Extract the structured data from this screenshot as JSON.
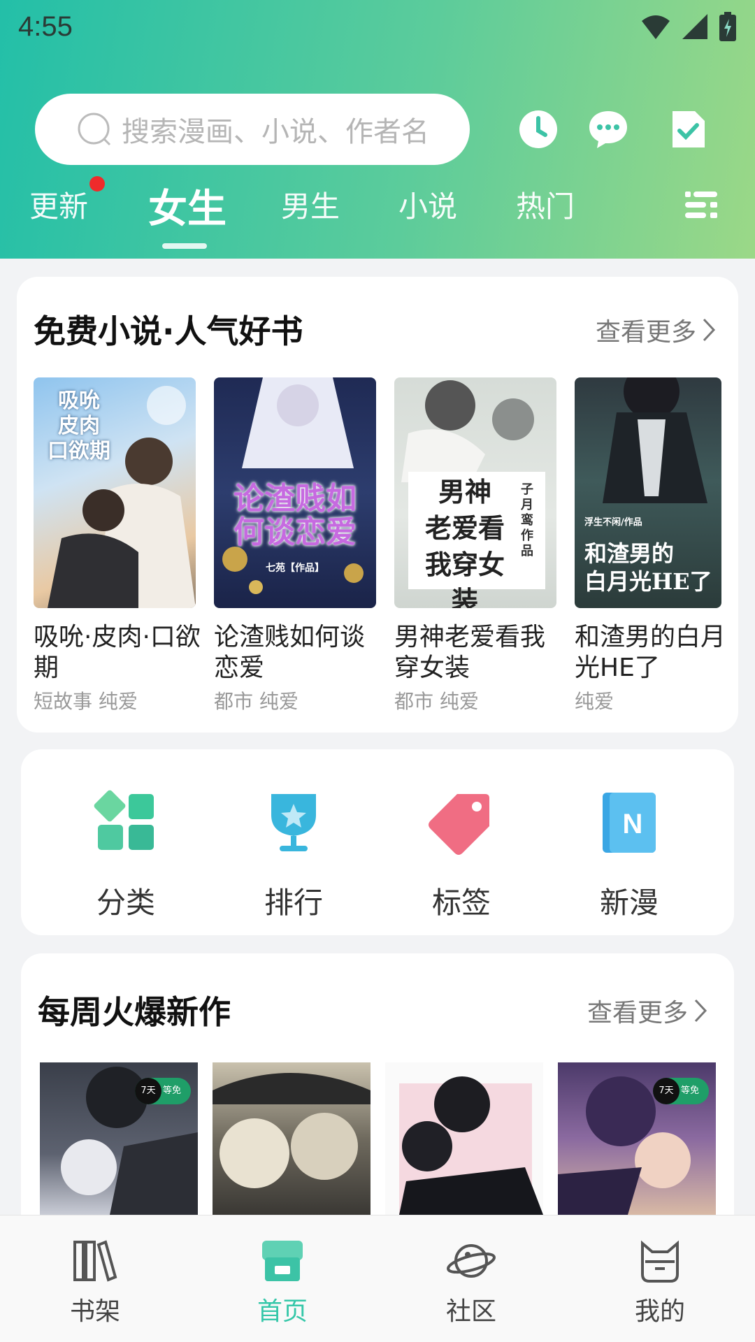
{
  "status_bar": {
    "time": "4:55"
  },
  "search": {
    "placeholder": "搜索漫画、小说、作者名"
  },
  "header_icons": [
    "clock-icon",
    "message-icon",
    "checkin-icon"
  ],
  "tabs": [
    {
      "label": "更新",
      "has_dot": true
    },
    {
      "label": "女生",
      "active": true
    },
    {
      "label": "男生"
    },
    {
      "label": "小说"
    },
    {
      "label": "热门"
    }
  ],
  "section1": {
    "title": "免费小说·人气好书",
    "more": "查看更多",
    "books": [
      {
        "title": "吸吮·皮肉·口欲期",
        "tags": "短故事 纯爱",
        "cover_text": "吸吮\n皮肉\n口欲期"
      },
      {
        "title": "论渣贱如何谈恋爱",
        "tags": "都市 纯爱",
        "cover_text": "论渣贱如何谈恋爱",
        "cover_sub": "七苑【作品】"
      },
      {
        "title": "男神老爱看我穿女装",
        "tags": "都市 纯爱",
        "cover_text": "男神老爱看我穿女装",
        "cover_sub": "子月鸾 作品"
      },
      {
        "title": "和渣男的白月光HE了",
        "tags": "纯爱",
        "cover_text": "和渣男的白月光HE了",
        "cover_sub": "浮生不闲/作品"
      }
    ]
  },
  "quick_links": [
    {
      "label": "分类",
      "icon": "category-icon"
    },
    {
      "label": "排行",
      "icon": "trophy-icon"
    },
    {
      "label": "标签",
      "icon": "tag-icon"
    },
    {
      "label": "新漫",
      "icon": "new-comic-icon"
    }
  ],
  "section2": {
    "title": "每周火爆新作",
    "more": "查看更多",
    "badge_days": "7天",
    "badge_free": "等免"
  },
  "bottom_nav": [
    {
      "label": "书架",
      "icon": "bookshelf-icon"
    },
    {
      "label": "首页",
      "icon": "home-icon",
      "active": true
    },
    {
      "label": "社区",
      "icon": "planet-icon"
    },
    {
      "label": "我的",
      "icon": "profile-icon"
    }
  ],
  "colors": {
    "accent": "#35c7a9",
    "header_gradient_start": "#23bfa8",
    "header_gradient_end": "#9bd887",
    "notification_dot": "#ef2b2b"
  }
}
